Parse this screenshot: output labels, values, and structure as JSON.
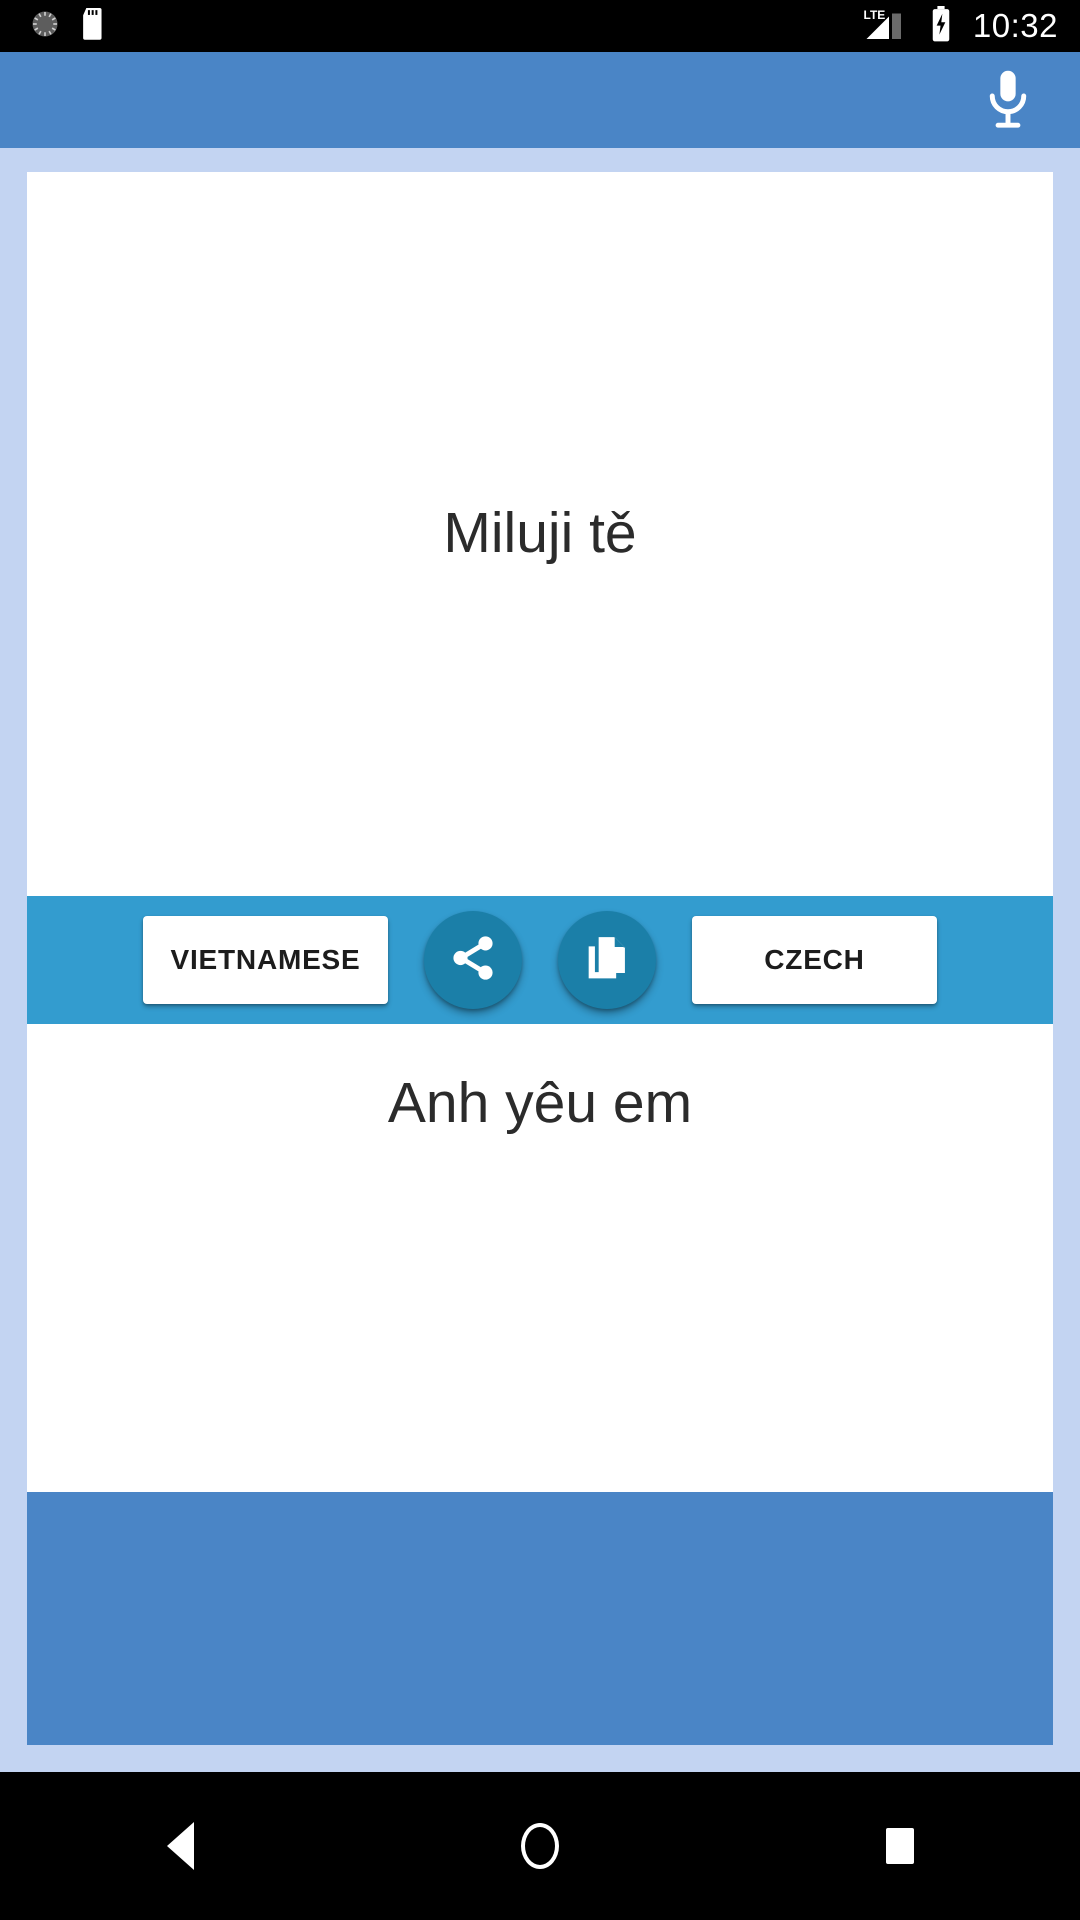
{
  "status_bar": {
    "icons": [
      "sync-spinner-icon",
      "sd-card-icon"
    ],
    "network_label": "LTE",
    "signal_icon": "signal-bars-icon",
    "battery_icon": "battery-charging-icon",
    "clock": "10:32"
  },
  "app_bar": {
    "title": "",
    "mic_icon": "microphone-icon",
    "background_color": "#4a85c6"
  },
  "translator": {
    "source_text": "Miluji tě",
    "target_text": "Anh yêu em",
    "source_language_button": "VIETNAMESE",
    "target_language_button": "CZECH",
    "share_icon": "share-icon",
    "copy_icon": "copy-icon",
    "action_bar_color": "#339ccf",
    "fab_color": "#1b7fa8"
  },
  "nav_bar": {
    "back": "back-triangle-icon",
    "home": "home-circle-icon",
    "recents": "recents-square-icon"
  },
  "theme": {
    "page_background": "#c3d4f2",
    "card_background": "#ffffff",
    "text_color": "#2b2b2b"
  }
}
